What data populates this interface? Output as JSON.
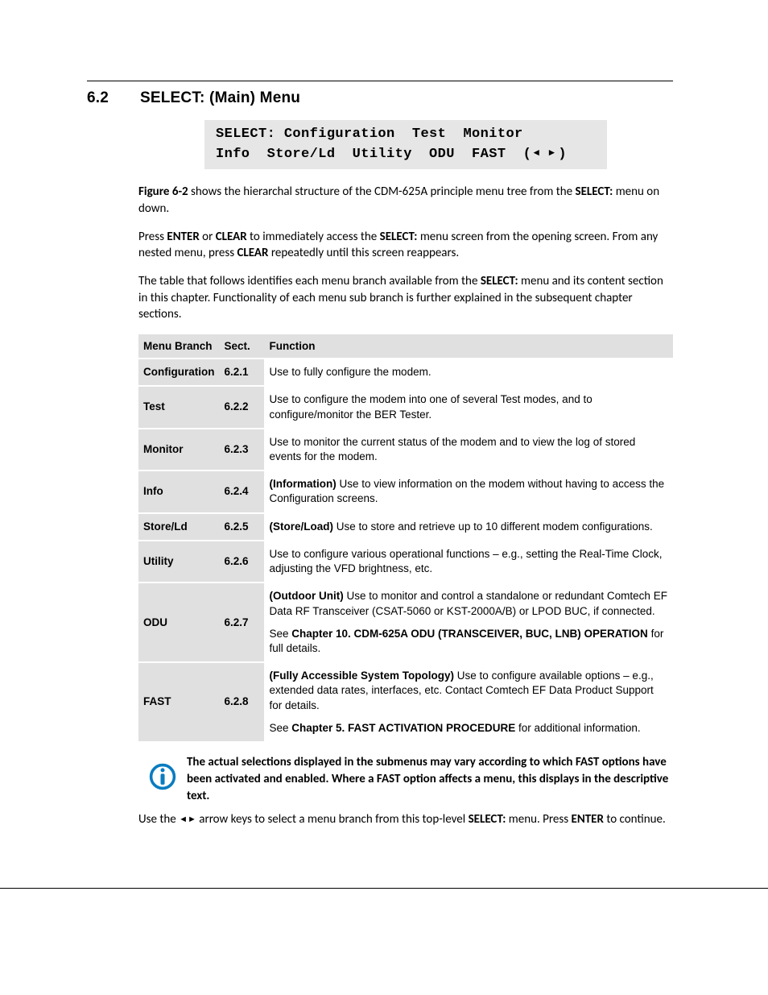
{
  "heading": {
    "num": "6.2",
    "title": "SELECT: (Main) Menu"
  },
  "lcd": {
    "line1": "SELECT: Configuration  Test  Monitor",
    "line2_a": "Info  Store/Ld  Utility  ODU  FAST  (",
    "line2_b": ")"
  },
  "para1": {
    "a": "Figure 6-2",
    "b": " shows the hierarchal structure of the CDM-625A principle menu tree from the ",
    "c": "SELECT:",
    "d": " menu on down."
  },
  "para2": {
    "a": "Press ",
    "b": "ENTER",
    "c": " or ",
    "d": "CLEAR",
    "e": " to immediately access the ",
    "f": "SELECT:",
    "g": " menu screen from the opening screen. From any nested menu, press ",
    "h": "CLEAR",
    "i": " repeatedly until this screen reappears."
  },
  "para3": {
    "a": "The table that follows identifies each menu branch available from the ",
    "b": "SELECT:",
    "c": " menu and its content section in this chapter. Functionality of each menu sub branch is further explained in the subsequent chapter sections."
  },
  "table": {
    "headers": {
      "branch": "Menu Branch",
      "sect": "Sect.",
      "func": "Function"
    },
    "rows": [
      {
        "branch": "Configuration",
        "sect": "6.2.1",
        "func_plain": "Use to fully configure the modem."
      },
      {
        "branch": "Test",
        "sect": "6.2.2",
        "func_plain": "Use to configure the modem into one of several Test modes, and to configure/monitor the BER Tester."
      },
      {
        "branch": "Monitor",
        "sect": "6.2.3",
        "func_plain": "Use to monitor the current status of the modem and to view the log of stored events for the modem."
      },
      {
        "branch": "Info",
        "sect": "6.2.4",
        "bold": "(Information) ",
        "rest": "Use to view information on the modem without having to access the Configuration screens."
      },
      {
        "branch": "Store/Ld",
        "sect": "6.2.5",
        "bold": "(Store/Load) ",
        "rest": "Use to store and retrieve up to 10 different modem configurations."
      },
      {
        "branch": "Utility",
        "sect": "6.2.6",
        "func_plain": "Use to configure various operational functions – e.g., setting the Real-Time Clock, adjusting the VFD brightness, etc."
      },
      {
        "branch": "ODU",
        "sect": "6.2.7",
        "p1_bold": "(Outdoor Unit)",
        "p1_rest": " Use to monitor and control a standalone or redundant Comtech EF Data RF Transceiver (CSAT-5060 or KST-2000A/B) or LPOD BUC, if connected.",
        "p2_a": "See ",
        "p2_bold": "Chapter 10. CDM-625A ODU (TRANSCEIVER, BUC, LNB) OPERATION",
        "p2_c": " for full details."
      },
      {
        "branch": "FAST",
        "sect": "6.2.8",
        "p1_bold": "(Fully Accessible System Topology) ",
        "p1_rest": "Use to configure available options – e.g., extended data rates, interfaces, etc. Contact Comtech EF Data Product Support for details.",
        "p2_a": "See ",
        "p2_bold": "Chapter 5. FAST ACTIVATION PROCEDURE",
        "p2_c": " for additional information."
      }
    ]
  },
  "note": "The actual selections displayed in the submenus may vary according to which FAST options have been activated and enabled. Where a FAST option affects a menu, this displays in the descriptive text.",
  "closing": {
    "a": "Use the ",
    "b": " arrow keys to select a menu branch from this top-level ",
    "c": "SELECT:",
    "d": " menu. Press ",
    "e": "ENTER",
    "f": " to continue."
  }
}
